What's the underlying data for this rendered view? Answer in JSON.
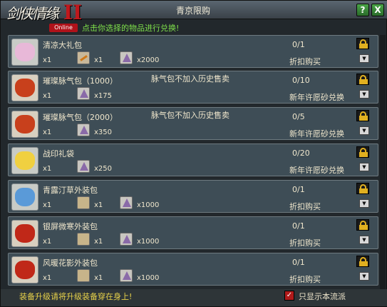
{
  "window": {
    "title": "青京限购"
  },
  "logo": {
    "text": "剑侠情缘",
    "numeral": "II",
    "badge": "Online"
  },
  "header": {
    "instruction": "点击你选择的物品进行兑换!"
  },
  "buttons": {
    "help": "?",
    "close": "X"
  },
  "items": [
    {
      "name": "清凉大礼包",
      "note": "",
      "count": "0/1",
      "mode": "折扣购买",
      "icon": "pink-gift-bag-icon",
      "icon_color": "#e8b8d8",
      "box_color": "#c8cbc6",
      "qty": "x1",
      "costs": [
        {
          "icon": "key-icon",
          "kind": "key",
          "value": "x1"
        },
        {
          "icon": "pyramid-icon",
          "kind": "pyramid",
          "value": "x2000"
        }
      ]
    },
    {
      "name": "璀璨脉气包（1000）",
      "note": "脉气包不加入历史售卖",
      "count": "0/10",
      "mode": "新年许愿砂兑换",
      "icon": "red-pouch-icon",
      "icon_color": "#c8401c",
      "box_color": "#d8d0c0",
      "qty": "x1",
      "costs": [
        {
          "icon": "pyramid-icon",
          "kind": "pyramid",
          "value": "x175"
        }
      ]
    },
    {
      "name": "璀璨脉气包（2000）",
      "note": "脉气包不加入历史售卖",
      "count": "0/5",
      "mode": "新年许愿砂兑换",
      "icon": "red-pouch-icon",
      "icon_color": "#c8401c",
      "box_color": "#d8d0c0",
      "qty": "x1",
      "costs": [
        {
          "icon": "pyramid-icon",
          "kind": "pyramid",
          "value": "x350"
        }
      ]
    },
    {
      "name": "战印礼袋",
      "note": "",
      "count": "0/20",
      "mode": "新年许愿砂兑换",
      "icon": "yellow-bag-icon",
      "icon_color": "#f0d040",
      "box_color": "#c8cbc6",
      "qty": "x1",
      "costs": [
        {
          "icon": "pyramid-icon",
          "kind": "pyramid",
          "value": "x250"
        }
      ]
    },
    {
      "name": "青露汀草外装包",
      "note": "",
      "count": "0/1",
      "mode": "折扣购买",
      "icon": "blue-package-icon",
      "icon_color": "#5a9ad8",
      "box_color": "#c8cbc6",
      "qty": "x1",
      "costs": [
        {
          "icon": "scroll-icon",
          "kind": "scroll",
          "value": "x1"
        },
        {
          "icon": "pyramid-icon",
          "kind": "pyramid",
          "value": "x1000"
        }
      ]
    },
    {
      "name": "银屏微寒外装包",
      "note": "",
      "count": "0/1",
      "mode": "折扣购买",
      "icon": "red-ornate-bag-icon",
      "icon_color": "#c02818",
      "box_color": "#d8d0c0",
      "qty": "x1",
      "costs": [
        {
          "icon": "scroll-icon",
          "kind": "scroll",
          "value": "x1"
        },
        {
          "icon": "pyramid-icon",
          "kind": "pyramid",
          "value": "x1000"
        }
      ]
    },
    {
      "name": "风暖花影外装包",
      "note": "",
      "count": "0/1",
      "mode": "折扣购买",
      "icon": "red-ornate-bag-icon",
      "icon_color": "#c02818",
      "box_color": "#d8d0c0",
      "qty": "x1",
      "costs": [
        {
          "icon": "scroll-icon",
          "kind": "scroll",
          "value": "x1"
        },
        {
          "icon": "pyramid-icon",
          "kind": "pyramid",
          "value": "x1000"
        }
      ]
    }
  ],
  "footer": {
    "note": "装备升级请将升级装备穿在身上!",
    "checkbox_label": "只显示本流派",
    "checkbox_checked": true,
    "checkbox_mark": "✓"
  }
}
